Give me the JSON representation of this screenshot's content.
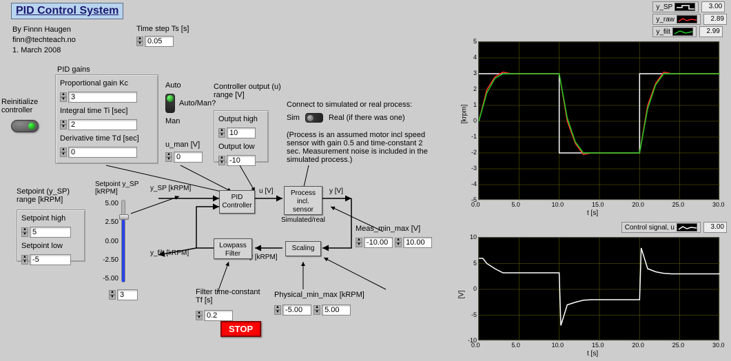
{
  "title": "PID Control System",
  "author": "By Finnn Haugen",
  "email": "finn@techteach.no",
  "date": "1. March 2008",
  "time_step": {
    "label": "Time step Ts [s]",
    "value": "0.05"
  },
  "reinit": {
    "label": "Reinitialize\ncontroller"
  },
  "pid_gains": {
    "group_label": "PID gains",
    "kc": {
      "label": "Proportional gain Kc",
      "value": "3"
    },
    "ti": {
      "label": "Integral time Ti [sec]",
      "value": "2"
    },
    "td": {
      "label": "Derivative time Td [sec]",
      "value": "0"
    }
  },
  "auto_man": {
    "auto": "Auto",
    "man": "Man",
    "label": "Auto/Man?"
  },
  "u_man": {
    "label": "u_man [V]",
    "value": "0"
  },
  "ctrl_out": {
    "label": "Controller output (u)\nrange [V]",
    "high_label": "Output high",
    "high_value": "10",
    "low_label": "Output low",
    "low_value": "-10"
  },
  "sim_real": {
    "label": "Connect to simulated or real process:",
    "sim": "Sim",
    "real": "Real (if there was one)",
    "note": "(Process is an assumed motor incl speed sensor with gain 0.5 and time-constant 2 sec. Measurement noise is included in the simulated process.)"
  },
  "sp_range": {
    "label": "Setpoint (y_SP)\nrange [kRPM]",
    "high_label": "Setpoint high",
    "high_value": "5",
    "low_label": "Setpoint low",
    "low_value": "-5"
  },
  "slider": {
    "label": "Setpoint y_SP\n[kRPM]",
    "ticks": [
      "5.00",
      "2.50",
      "0.00",
      "-2.50",
      "-5.00"
    ],
    "value": "3"
  },
  "diagram": {
    "y_sp": "y_SP [kRPM]",
    "u": "u [V]",
    "y": "y [V]",
    "y_filt": "y_filt [kRPM]",
    "y_krpm": "y [kRPM]",
    "pid": "PID\nController",
    "proc": "Process\nincl.\nsensor",
    "proc_sub": "Simulated/real",
    "lp": "Lowpass\nFilter",
    "sc": "Scaling"
  },
  "meas_minmax": {
    "label": "Meas_min_max [V]",
    "min": "-10.00",
    "max": "10.00"
  },
  "phys_minmax": {
    "label": "Physical_min_max [kRPM]",
    "min": "-5.00",
    "max": "5.00"
  },
  "filter_tf": {
    "label": "Filter time-constant\nTf [s]",
    "value": "0.2"
  },
  "stop": "STOP",
  "legend_top": [
    {
      "name": "y_SP",
      "color": "#ffffff",
      "value": "3.00"
    },
    {
      "name": "y_raw",
      "color": "#ff2a2a",
      "value": "2.89"
    },
    {
      "name": "y_filt",
      "color": "#20cc20",
      "value": "2.99"
    }
  ],
  "legend_bottom": {
    "name": "Control signal, u",
    "color": "#ffffff",
    "value": "3.00"
  },
  "chart_top": {
    "ylabel": "[krpm]",
    "xlabel": "t [s]"
  },
  "chart_bottom": {
    "ylabel": "[V]",
    "xlabel": "t [s]"
  },
  "chart_data": [
    {
      "type": "line",
      "title": "",
      "xlabel": "t [s]",
      "ylabel": "[krpm]",
      "xlim": [
        0,
        30
      ],
      "ylim": [
        -5,
        5
      ],
      "xticks": [
        0.0,
        5.0,
        10.0,
        15.0,
        20.0,
        25.0,
        30.0
      ],
      "yticks": [
        -5,
        -4,
        -3,
        -2,
        -1,
        0,
        1,
        2,
        3,
        4,
        5
      ],
      "series": [
        {
          "name": "y_SP",
          "color": "#ffffff",
          "x": [
            0,
            10,
            10,
            20,
            20,
            30
          ],
          "y": [
            3,
            3,
            -2,
            -2,
            3,
            3
          ]
        },
        {
          "name": "y_raw",
          "color": "#ff2a2a",
          "x": [
            0,
            1,
            2,
            3,
            4,
            10,
            11,
            12,
            13,
            14,
            20,
            21,
            22,
            23,
            24,
            30
          ],
          "y": [
            0,
            2.0,
            2.8,
            3.1,
            3.0,
            3.0,
            0.0,
            -1.4,
            -2.1,
            -2.0,
            -2.0,
            1.0,
            2.4,
            3.1,
            3.0,
            3.0
          ]
        },
        {
          "name": "y_filt",
          "color": "#20cc20",
          "x": [
            0,
            1,
            2,
            3,
            4,
            10,
            11,
            12,
            13,
            14,
            20,
            21,
            22,
            23,
            24,
            30
          ],
          "y": [
            0,
            1.8,
            2.7,
            3.0,
            3.0,
            3.0,
            0.2,
            -1.3,
            -2.0,
            -2.0,
            -2.0,
            0.8,
            2.3,
            3.0,
            3.0,
            3.0
          ]
        }
      ]
    },
    {
      "type": "line",
      "title": "",
      "xlabel": "t [s]",
      "ylabel": "[V]",
      "xlim": [
        0,
        30
      ],
      "ylim": [
        -10,
        10
      ],
      "xticks": [
        0.0,
        5.0,
        10.0,
        15.0,
        20.0,
        25.0,
        30.0
      ],
      "yticks": [
        -10,
        -5,
        0,
        5,
        10
      ],
      "series": [
        {
          "name": "Control signal, u",
          "color": "#ffffff",
          "x": [
            0,
            0.5,
            1,
            2,
            3,
            10,
            10.2,
            11,
            12,
            13,
            14,
            20,
            20.2,
            21,
            22,
            23,
            24,
            30
          ],
          "y": [
            6,
            6,
            5,
            4,
            3.2,
            3.2,
            -7,
            -3,
            -2.5,
            -2.1,
            -2.0,
            -2.0,
            8,
            4,
            3.4,
            3.1,
            3.0,
            3.0
          ]
        }
      ]
    }
  ]
}
